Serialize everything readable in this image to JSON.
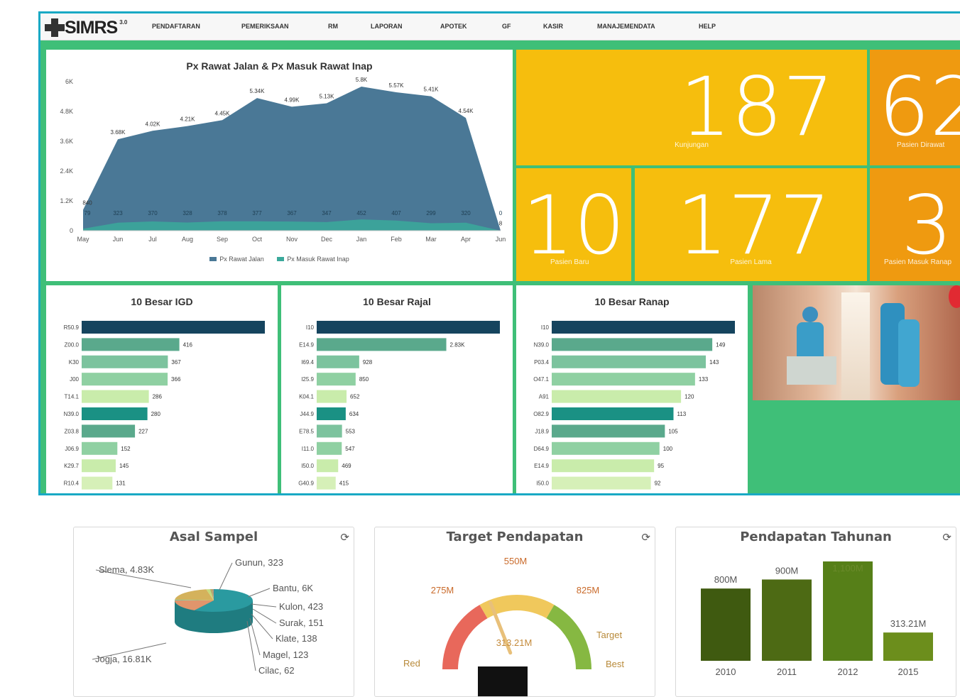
{
  "app": {
    "logo_text": "SIMRS",
    "logo_version": "3.0"
  },
  "nav": [
    "PENDAFTARAN",
    "PEMERIKSAAN",
    "RM",
    "LAPORAN",
    "APOTEK",
    "GF",
    "KASIR",
    "MANAJEMENDATA",
    "HELP"
  ],
  "area_chart": {
    "title": "Px Rawat Jalan & Px Masuk Rawat Inap",
    "legend": [
      "Px Rawat Jalan",
      "Px Masuk Rawat Inap"
    ]
  },
  "chart_data": [
    {
      "type": "area",
      "title": "Px Rawat Jalan & Px Masuk Rawat Inap",
      "categories": [
        "May",
        "Jun",
        "Jul",
        "Aug",
        "Sep",
        "Oct",
        "Nov",
        "Dec",
        "Jan",
        "Feb",
        "Mar",
        "Apr",
        "Jun"
      ],
      "y_ticks": [
        "0",
        "1.2K",
        "2.4K",
        "3.6K",
        "4.8K",
        "6K"
      ],
      "ylim": [
        0,
        6000
      ],
      "series": [
        {
          "name": "Px Rawat Jalan",
          "color": "#4a7896",
          "values": [
            840,
            3680,
            4020,
            4210,
            4450,
            5340,
            4990,
            5130,
            5800,
            5570,
            5410,
            4540,
            8
          ],
          "labels": [
            "840",
            "3.68K",
            "4.02K",
            "4.21K",
            "4.45K",
            "5.34K",
            "4.99K",
            "5.13K",
            "5.8K",
            "5.57K",
            "5.41K",
            "4.54K",
            "8"
          ]
        },
        {
          "name": "Px Masuk Rawat Inap",
          "color": "#3aa99b",
          "values": [
            79,
            323,
            370,
            328,
            378,
            377,
            367,
            347,
            452,
            407,
            299,
            320,
            0
          ],
          "labels": [
            "79",
            "323",
            "370",
            "328",
            "378",
            "377",
            "367",
            "347",
            "452",
            "407",
            "299",
            "320",
            "0"
          ]
        }
      ]
    },
    {
      "type": "bar",
      "title": "10 Besar IGD",
      "categories": [
        "R50.9",
        "Z00.0",
        "K30",
        "J00",
        "T14.1",
        "N39.0",
        "Z03.8",
        "J06.9",
        "K29.7",
        "R10.4"
      ],
      "values": [
        780,
        416,
        367,
        366,
        286,
        280,
        227,
        152,
        145,
        131
      ],
      "labels": [
        "",
        "416",
        "367",
        "366",
        "286",
        "280",
        "227",
        "152",
        "145",
        "131"
      ]
    },
    {
      "type": "bar",
      "title": "10 Besar Rajal",
      "categories": [
        "I10",
        "E14.9",
        "I69.4",
        "I25.9",
        "K04.1",
        "J44.9",
        "E78.5",
        "I11.0",
        "I50.0",
        "G40.9"
      ],
      "values": [
        4000,
        2830,
        928,
        850,
        652,
        634,
        553,
        547,
        469,
        415
      ],
      "labels": [
        "",
        "2.83K",
        "928",
        "850",
        "652",
        "634",
        "553",
        "547",
        "469",
        "415"
      ]
    },
    {
      "type": "bar",
      "title": "10 Besar Ranap",
      "categories": [
        "I10",
        "N39.0",
        "P03.4",
        "O47.1",
        "A91",
        "O82.9",
        "J18.9",
        "D64.9",
        "E14.9",
        "I50.0"
      ],
      "values": [
        170,
        149,
        143,
        133,
        120,
        113,
        105,
        100,
        95,
        92
      ],
      "labels": [
        "",
        "149",
        "143",
        "133",
        "120",
        "113",
        "105",
        "100",
        "95",
        "92"
      ]
    },
    {
      "type": "pie",
      "title": "Asal Sampel",
      "categories": [
        "Jogja",
        "Slema",
        "Gunun",
        "Bantu",
        "Kulon",
        "Surak",
        "Klate",
        "Magel",
        "Cilac"
      ],
      "values": [
        16810,
        4830,
        323,
        6000,
        423,
        151,
        138,
        123,
        62
      ],
      "labels": [
        "Jogja, 16.81K",
        "Slema, 4.83K",
        "Gunun, 323",
        "Bantu, 6K",
        "Kulon, 423",
        "Surak, 151",
        "Klate, 138",
        "Magel, 123",
        "Cilac, 62"
      ]
    },
    {
      "type": "bar",
      "title": "Pendapatan Tahunan",
      "categories": [
        "2010",
        "2011",
        "2012",
        "2015"
      ],
      "values": [
        800,
        900,
        1100,
        313.21
      ],
      "labels": [
        "800M",
        "900M",
        "1,100M",
        "313.21M"
      ]
    }
  ],
  "tiles": {
    "kunjungan": {
      "value": "187",
      "label": "Kunjungan"
    },
    "dirawat": {
      "value": "62",
      "label": "Pasien Dirawat"
    },
    "baru": {
      "value": "10",
      "label": "Pasien Baru"
    },
    "lama": {
      "value": "177",
      "label": "Pasien Lama"
    },
    "masuk_ranap": {
      "value": "3",
      "label": "Pasien Masuk Ranap"
    }
  },
  "gauge": {
    "title": "Target Pendapatan",
    "value_label": "313.21M",
    "value": 313.21,
    "max": 825,
    "ticks": [
      "275M",
      "550M",
      "825M"
    ],
    "bands": [
      "Red",
      "Target",
      "Best"
    ]
  },
  "widgets": {
    "asal": "Asal Sampel",
    "target": "Target Pendapatan",
    "tahunan": "Pendapatan Tahunan"
  },
  "colors": {
    "frame": "#19a9c4",
    "green_bg": "#3fbf78",
    "tile_yellow": "#f6be0d",
    "tile_orange": "#ef9a10",
    "area": "#4a7896",
    "bar_top": "#15445e",
    "bar_pale": "#c9ecab"
  }
}
